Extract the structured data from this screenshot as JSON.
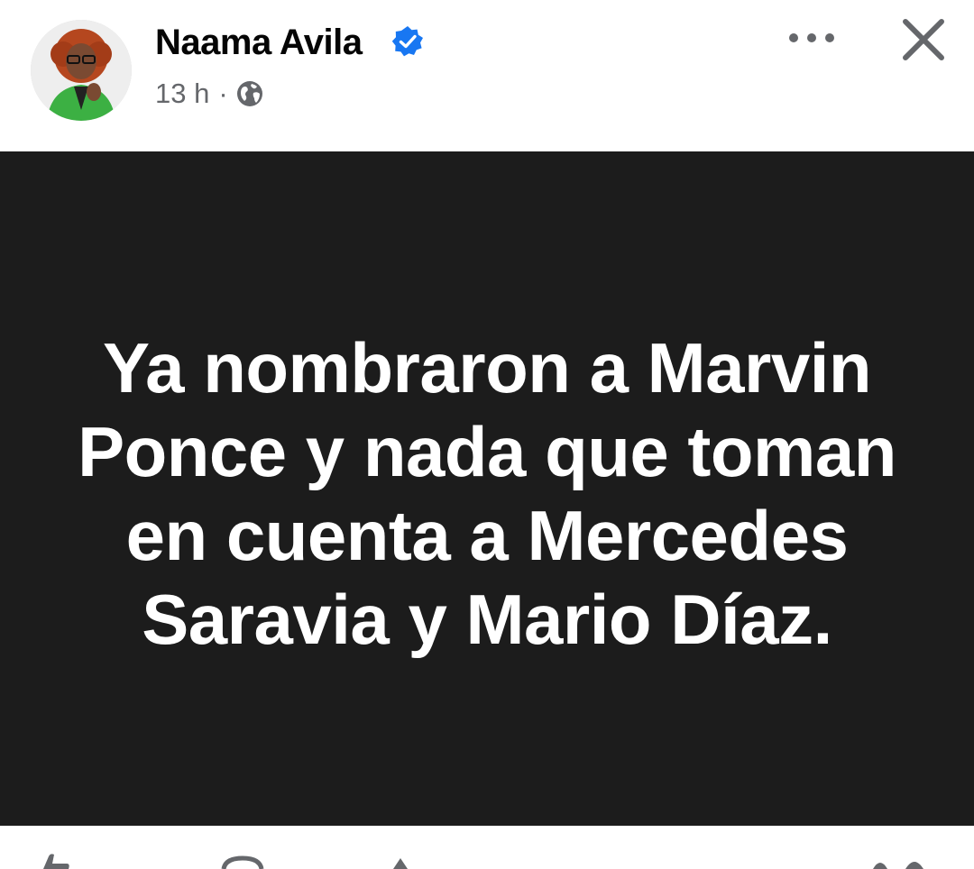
{
  "post": {
    "author": "Naama Avila",
    "verified": true,
    "timestamp": "13 h",
    "separator": "·",
    "audience_icon": "globe-icon",
    "text": "Ya nombraron a Marvin Ponce y nada que toman en cuenta a Mercedes Saravia y Mario Díaz."
  },
  "header_actions": {
    "more_icon": "more-horizontal-icon",
    "close_icon": "close-icon"
  },
  "colors": {
    "verified_badge": "#1877f2",
    "post_background": "#1c1c1c",
    "secondary_text": "#65676b",
    "avatar_jacket": "#3cb043"
  }
}
